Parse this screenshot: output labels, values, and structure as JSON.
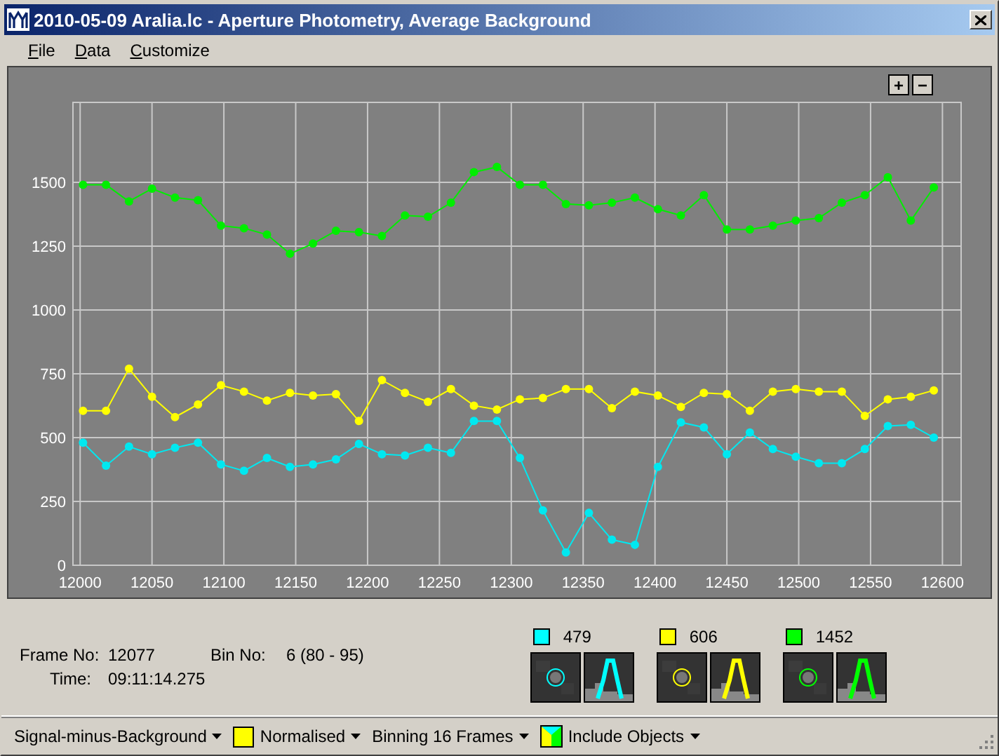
{
  "window": {
    "title": "2010-05-09 Aralia.lc - Aperture Photometry, Average Background"
  },
  "menu": [
    {
      "label": "File"
    },
    {
      "label": "Data"
    },
    {
      "label": "Customize"
    }
  ],
  "zoom_buttons": [
    "+",
    "−"
  ],
  "chart": {
    "chart_data": {
      "type": "line",
      "x": [
        12002,
        12018,
        12034,
        12050,
        12066,
        12082,
        12098,
        12114,
        12130,
        12146,
        12162,
        12178,
        12194,
        12210,
        12226,
        12242,
        12258,
        12274,
        12290,
        12306,
        12322,
        12338,
        12354,
        12370,
        12386,
        12402,
        12418,
        12434,
        12450,
        12466,
        12482,
        12498,
        12514,
        12530,
        12546,
        12562,
        12578,
        12594
      ],
      "series": [
        {
          "name": "479",
          "color": "#00e8f0",
          "marker": "circle",
          "values": [
            480,
            390,
            465,
            435,
            460,
            480,
            395,
            370,
            420,
            385,
            395,
            415,
            475,
            435,
            430,
            460,
            440,
            565,
            565,
            420,
            215,
            50,
            205,
            100,
            80,
            385,
            560,
            540,
            435,
            520,
            455,
            425,
            400,
            400,
            455,
            545,
            550,
            500
          ]
        },
        {
          "name": "606",
          "color": "#ffff00",
          "marker": "circle",
          "values": [
            605,
            605,
            770,
            660,
            580,
            630,
            705,
            680,
            645,
            675,
            665,
            670,
            565,
            725,
            675,
            640,
            690,
            625,
            610,
            650,
            655,
            690,
            690,
            615,
            680,
            665,
            620,
            675,
            670,
            605,
            680,
            690,
            680,
            680,
            585,
            650,
            660,
            685
          ]
        },
        {
          "name": "1452",
          "color": "#00ee00",
          "marker": "circle",
          "values": [
            1490,
            1490,
            1425,
            1475,
            1440,
            1430,
            1330,
            1320,
            1295,
            1220,
            1260,
            1310,
            1305,
            1290,
            1370,
            1365,
            1420,
            1540,
            1560,
            1490,
            1490,
            1415,
            1410,
            1420,
            1440,
            1395,
            1370,
            1450,
            1315,
            1315,
            1330,
            1350,
            1360,
            1420,
            1450,
            1520,
            1350,
            1480
          ]
        }
      ],
      "grid": true,
      "xlim": [
        11995,
        12613
      ],
      "ylim": [
        0,
        1813
      ],
      "xticks": [
        12000,
        12050,
        12100,
        12150,
        12200,
        12250,
        12300,
        12350,
        12400,
        12450,
        12500,
        12550,
        12600
      ],
      "yticks": [
        0,
        250,
        500,
        750,
        1000,
        1250,
        1500
      ]
    }
  },
  "info": {
    "frame_label": "Frame No:",
    "frame_value": "12077",
    "time_label": "Time:",
    "time_value": "09:11:14.275",
    "bin_label": "Bin No:",
    "bin_value": "6 (80 - 95)"
  },
  "objects": [
    {
      "color": "#00ffff"
    },
    {
      "color": "#ffff00"
    },
    {
      "color": "#00ff00"
    }
  ],
  "toolbar": [
    {
      "kind": "dropdown",
      "label": "Signal-minus-Background"
    },
    {
      "kind": "swatch",
      "label": "Normalised",
      "color": "#ffff00"
    },
    {
      "kind": "dropdown",
      "label": "Binning 16 Frames"
    },
    {
      "kind": "objects",
      "label": "Include Objects"
    }
  ]
}
